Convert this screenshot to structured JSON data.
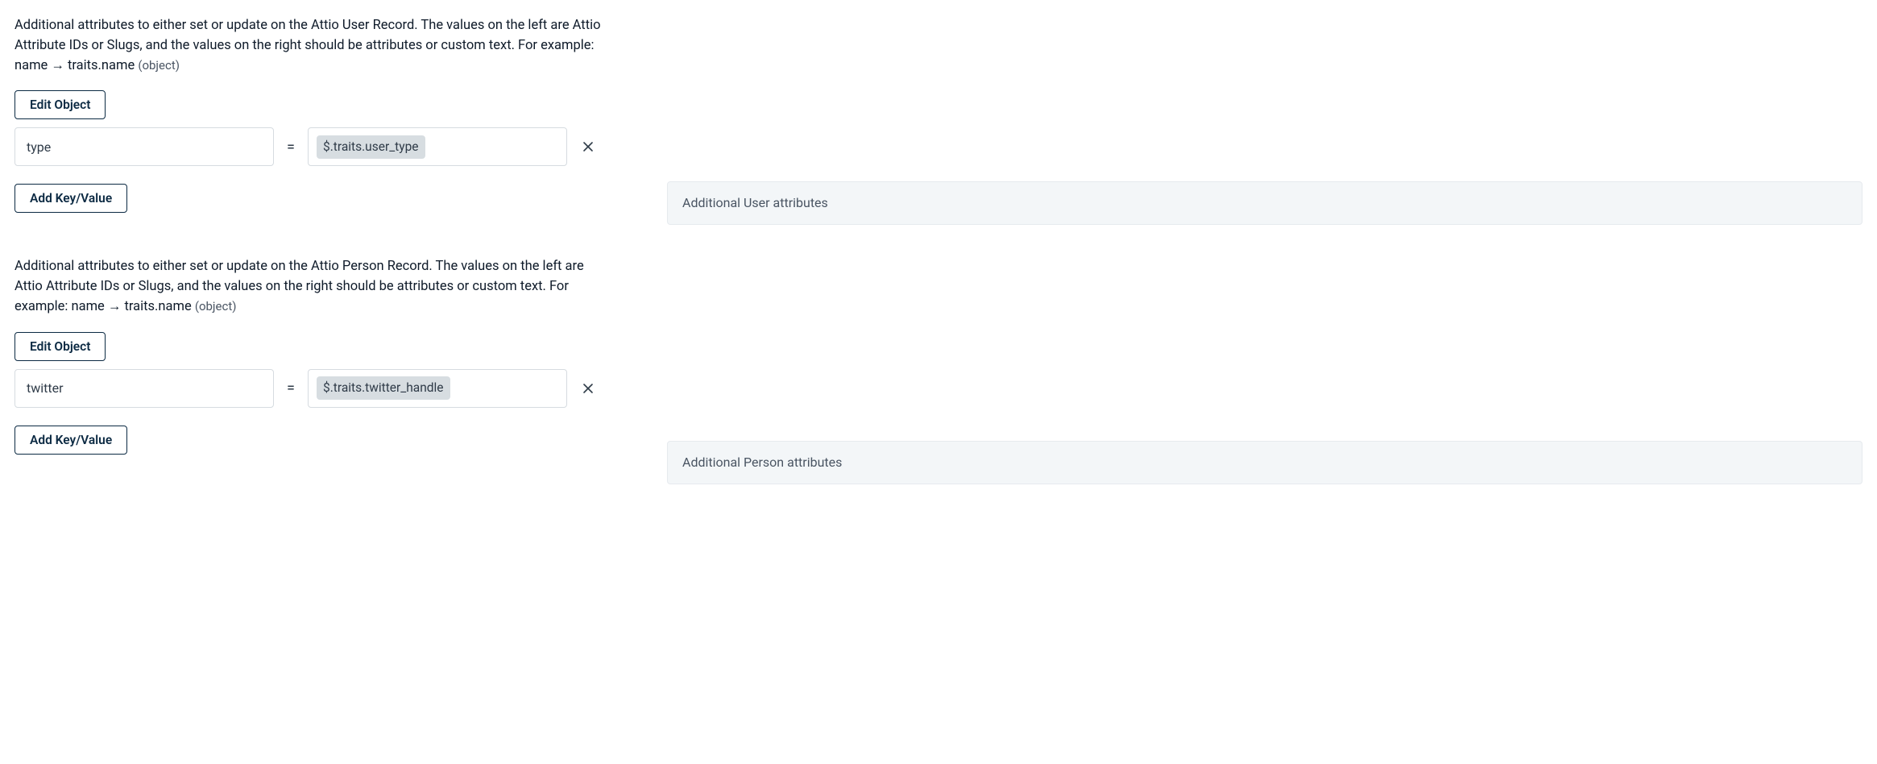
{
  "sections": [
    {
      "description_main": "Additional attributes to either set or update on the Attio User Record. The values on the left are Attio Attribute IDs or Slugs, and the values on the right should be attributes or custom text. For example: name → traits.name ",
      "description_type": "(object)",
      "edit_object_label": "Edit Object",
      "key_value": "type",
      "value_token": "$.traits.user_type",
      "equals": "=",
      "add_kv_label": "Add Key/Value",
      "right_label": "Additional User attributes"
    },
    {
      "description_main": "Additional attributes to either set or update on the Attio Person Record. The values on the left are Attio Attribute IDs or Slugs, and the values on the right should be attributes or custom text. For example: name → traits.name ",
      "description_type": "(object)",
      "edit_object_label": "Edit Object",
      "key_value": "twitter",
      "value_token": "$.traits.twitter_handle",
      "equals": "=",
      "add_kv_label": "Add Key/Value",
      "right_label": "Additional Person attributes"
    }
  ]
}
